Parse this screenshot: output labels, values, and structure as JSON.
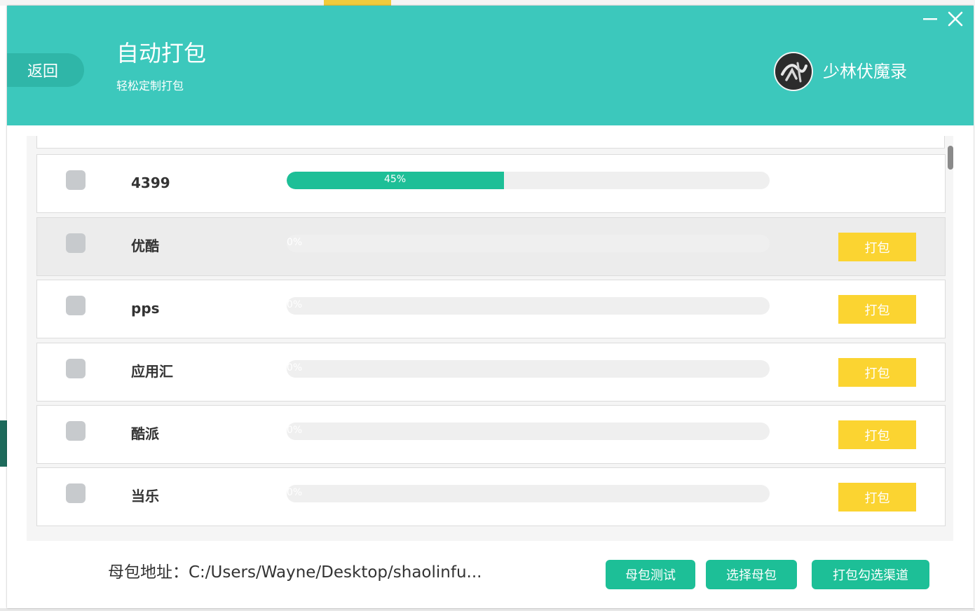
{
  "window": {
    "title": "自动打包",
    "subtitle": "轻松定制打包",
    "back_label": "返回",
    "game_name": "少林伏魔录",
    "minimize_glyph": "—",
    "close_glyph": "✕"
  },
  "channels": [
    {
      "name": "4399",
      "progress": 45,
      "progress_label": "45%",
      "checked": false,
      "button_label": ""
    },
    {
      "name": "优酷",
      "progress": 0,
      "progress_label": "0%",
      "checked": false,
      "button_label": "打包"
    },
    {
      "name": "pps",
      "progress": 0,
      "progress_label": "0%",
      "checked": false,
      "button_label": "打包"
    },
    {
      "name": "应用汇",
      "progress": 0,
      "progress_label": "0%",
      "checked": false,
      "button_label": "打包"
    },
    {
      "name": "酷派",
      "progress": 0,
      "progress_label": "0%",
      "checked": false,
      "button_label": "打包"
    },
    {
      "name": "当乐",
      "progress": 0,
      "progress_label": "0%",
      "checked": false,
      "button_label": "打包"
    }
  ],
  "footer": {
    "path_label": "母包地址：C:/Users/Wayne/Desktop/shaolinfu...",
    "test_button": "母包测试",
    "select_button": "选择母包",
    "pack_selected_button": "打包勾选渠道"
  },
  "colors": {
    "header_bg": "#3cc8bc",
    "back_button_bg": "#2fb6a8",
    "progress_fill": "#1dbf97",
    "pack_button_bg": "#fbd431",
    "footer_button_bg": "#1dbf97",
    "checkbox": "#c7cacd"
  },
  "icons": {
    "game_logo": "shaolin-calligraphy-logo-icon",
    "minimize": "minimize-icon",
    "close": "close-icon"
  }
}
